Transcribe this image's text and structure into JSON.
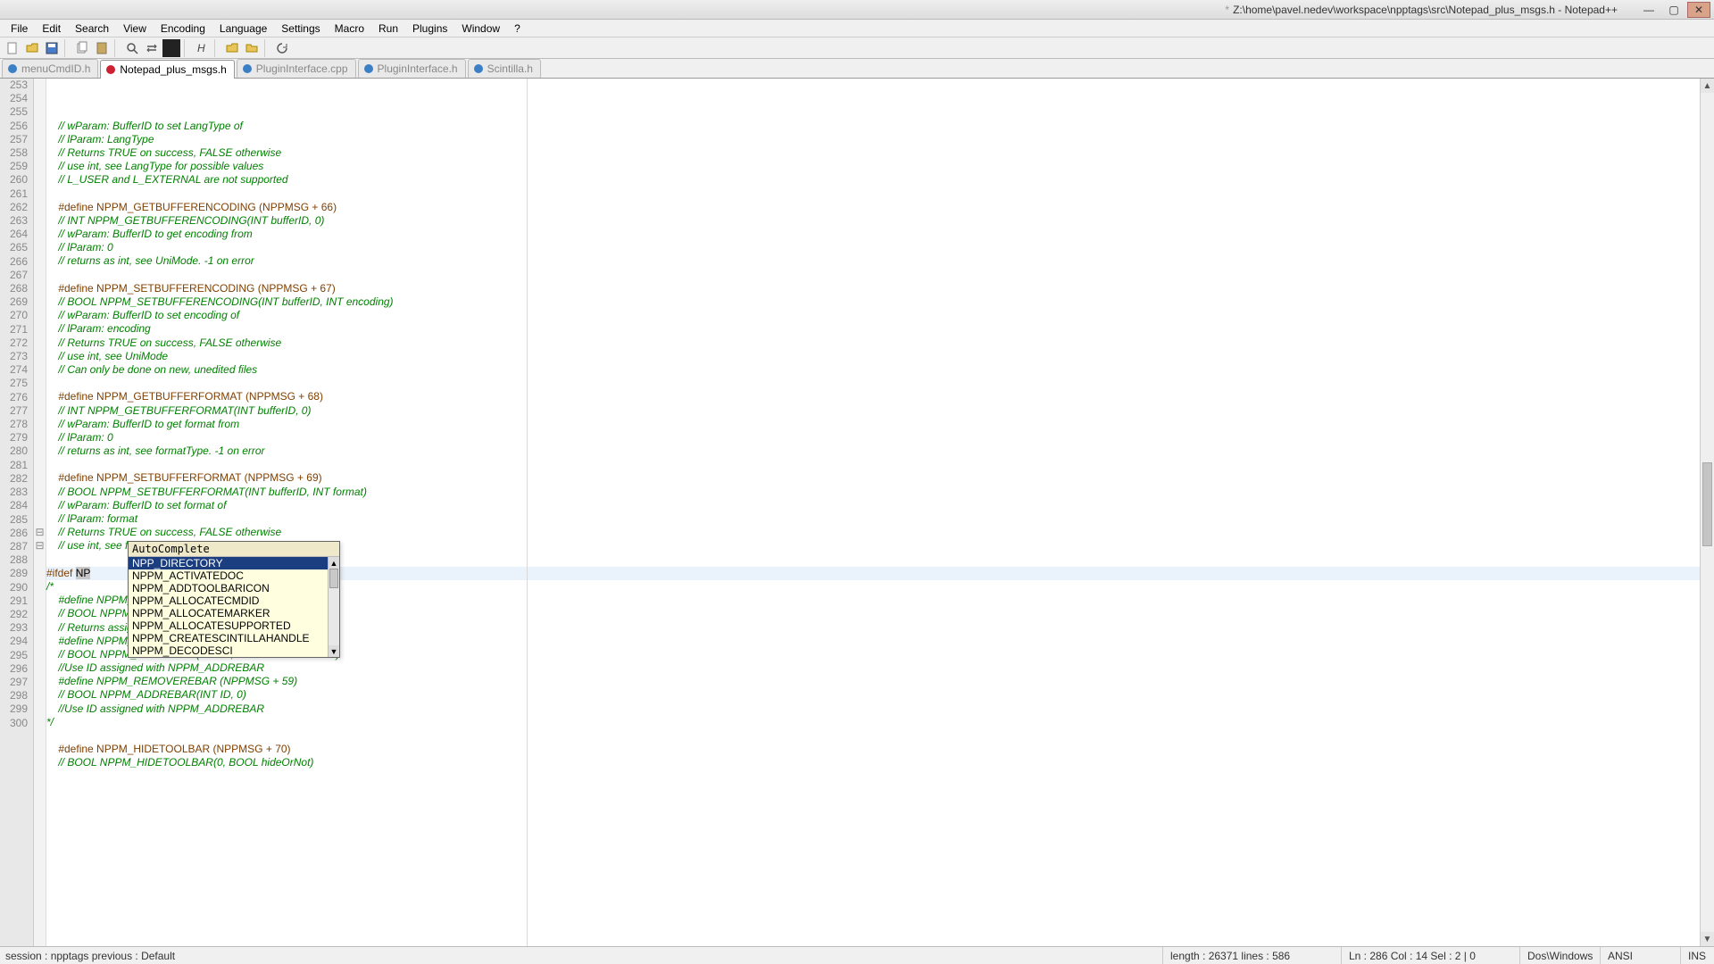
{
  "titlebar": {
    "modified_mark": "*",
    "path": "Z:\\home\\pavel.nedev\\workspace\\npptags\\src\\Notepad_plus_msgs.h - Notepad++"
  },
  "menu": [
    "File",
    "Edit",
    "Search",
    "View",
    "Encoding",
    "Language",
    "Settings",
    "Macro",
    "Run",
    "Plugins",
    "Window",
    "?"
  ],
  "tabs": [
    {
      "label": "menuCmdID.h",
      "active": false,
      "dirty": false
    },
    {
      "label": "Notepad_plus_msgs.h",
      "active": true,
      "dirty": true
    },
    {
      "label": "PluginInterface.cpp",
      "active": false,
      "dirty": false
    },
    {
      "label": "PluginInterface.h",
      "active": false,
      "dirty": false
    },
    {
      "label": "Scintilla.h",
      "active": false,
      "dirty": false
    }
  ],
  "first_line": 253,
  "code_lines": [
    {
      "c": "cc",
      "t": "    // wParam: BufferID to set LangType of"
    },
    {
      "c": "cc",
      "t": "    // lParam: LangType"
    },
    {
      "c": "cc",
      "t": "    // Returns TRUE on success, FALSE otherwise"
    },
    {
      "c": "cc",
      "t": "    // use int, see LangType for possible values"
    },
    {
      "c": "cc",
      "t": "    // L_USER and L_EXTERNAL are not supported"
    },
    {
      "c": "",
      "t": ""
    },
    {
      "c": "cd",
      "t": "    #define NPPM_GETBUFFERENCODING (NPPMSG + 66)"
    },
    {
      "c": "cc",
      "t": "    // INT NPPM_GETBUFFERENCODING(INT bufferID, 0)"
    },
    {
      "c": "cc",
      "t": "    // wParam: BufferID to get encoding from"
    },
    {
      "c": "cc",
      "t": "    // lParam: 0"
    },
    {
      "c": "cc",
      "t": "    // returns as int, see UniMode. -1 on error"
    },
    {
      "c": "",
      "t": ""
    },
    {
      "c": "cd",
      "t": "    #define NPPM_SETBUFFERENCODING (NPPMSG + 67)"
    },
    {
      "c": "cc",
      "t": "    // BOOL NPPM_SETBUFFERENCODING(INT bufferID, INT encoding)"
    },
    {
      "c": "cc",
      "t": "    // wParam: BufferID to set encoding of"
    },
    {
      "c": "cc",
      "t": "    // lParam: encoding"
    },
    {
      "c": "cc",
      "t": "    // Returns TRUE on success, FALSE otherwise"
    },
    {
      "c": "cc",
      "t": "    // use int, see UniMode"
    },
    {
      "c": "cc",
      "t": "    // Can only be done on new, unedited files"
    },
    {
      "c": "",
      "t": ""
    },
    {
      "c": "cd",
      "t": "    #define NPPM_GETBUFFERFORMAT (NPPMSG + 68)"
    },
    {
      "c": "cc",
      "t": "    // INT NPPM_GETBUFFERFORMAT(INT bufferID, 0)"
    },
    {
      "c": "cc",
      "t": "    // wParam: BufferID to get format from"
    },
    {
      "c": "cc",
      "t": "    // lParam: 0"
    },
    {
      "c": "cc",
      "t": "    // returns as int, see formatType. -1 on error"
    },
    {
      "c": "",
      "t": ""
    },
    {
      "c": "cd",
      "t": "    #define NPPM_SETBUFFERFORMAT (NPPMSG + 69)"
    },
    {
      "c": "cc",
      "t": "    // BOOL NPPM_SETBUFFERFORMAT(INT bufferID, INT format)"
    },
    {
      "c": "cc",
      "t": "    // wParam: BufferID to set format of"
    },
    {
      "c": "cc",
      "t": "    // lParam: format"
    },
    {
      "c": "cc",
      "t": "    // Returns TRUE on success, FALSE otherwise"
    },
    {
      "c": "cc",
      "t": "    // use int, see formatType"
    },
    {
      "c": "",
      "t": ""
    },
    {
      "c": "cd",
      "t": "#ifdef ",
      "tail": "NP",
      "cur": true,
      "fold": "⊟"
    },
    {
      "c": "cc",
      "t": "/*",
      "fold": "⊟"
    },
    {
      "c": "cc",
      "t": "    #define NPPM_ADDREBAR (NPPMSG + 57)"
    },
    {
      "c": "cc",
      "t": "    // BOOL NPPM_ADDREBAR(0, REBARBANDINFO *)"
    },
    {
      "c": "cc",
      "t": "    // Returns assigned ID in wID value of struct pointer"
    },
    {
      "c": "cc",
      "t": "    #define NPPM_UPDATEREBAR (NPPMSG + 58)"
    },
    {
      "c": "cc",
      "t": "    // BOOL NPPM_ADDREBAR(INT ID, REBARBANDINFO *)"
    },
    {
      "c": "cc",
      "t": "    //Use ID assigned with NPPM_ADDREBAR"
    },
    {
      "c": "cc",
      "t": "    #define NPPM_REMOVEREBAR (NPPMSG + 59)"
    },
    {
      "c": "cc",
      "t": "    // BOOL NPPM_ADDREBAR(INT ID, 0)"
    },
    {
      "c": "cc",
      "t": "    //Use ID assigned with NPPM_ADDREBAR"
    },
    {
      "c": "cc",
      "t": "*/"
    },
    {
      "c": "",
      "t": ""
    },
    {
      "c": "cd",
      "t": "    #define NPPM_HIDETOOLBAR (NPPMSG + 70)"
    },
    {
      "c": "cc",
      "t": "    // BOOL NPPM_HIDETOOLBAR(0, BOOL hideOrNot)"
    }
  ],
  "autocomplete": {
    "title": "AutoComplete",
    "items": [
      "NPP_DIRECTORY",
      "NPPM_ACTIVATEDOC",
      "NPPM_ADDTOOLBARICON",
      "NPPM_ALLOCATECMDID",
      "NPPM_ALLOCATEMARKER",
      "NPPM_ALLOCATESUPPORTED",
      "NPPM_CREATESCINTILLAHANDLE",
      "NPPM_DECODESCI"
    ],
    "selected": 0
  },
  "status": {
    "left": "session : npptags    previous : Default",
    "length": "length : 26371    lines : 586",
    "pos": "Ln : 286    Col : 14    Sel : 2 | 0",
    "eol": "Dos\\Windows",
    "enc": "ANSI",
    "ins": "INS"
  }
}
